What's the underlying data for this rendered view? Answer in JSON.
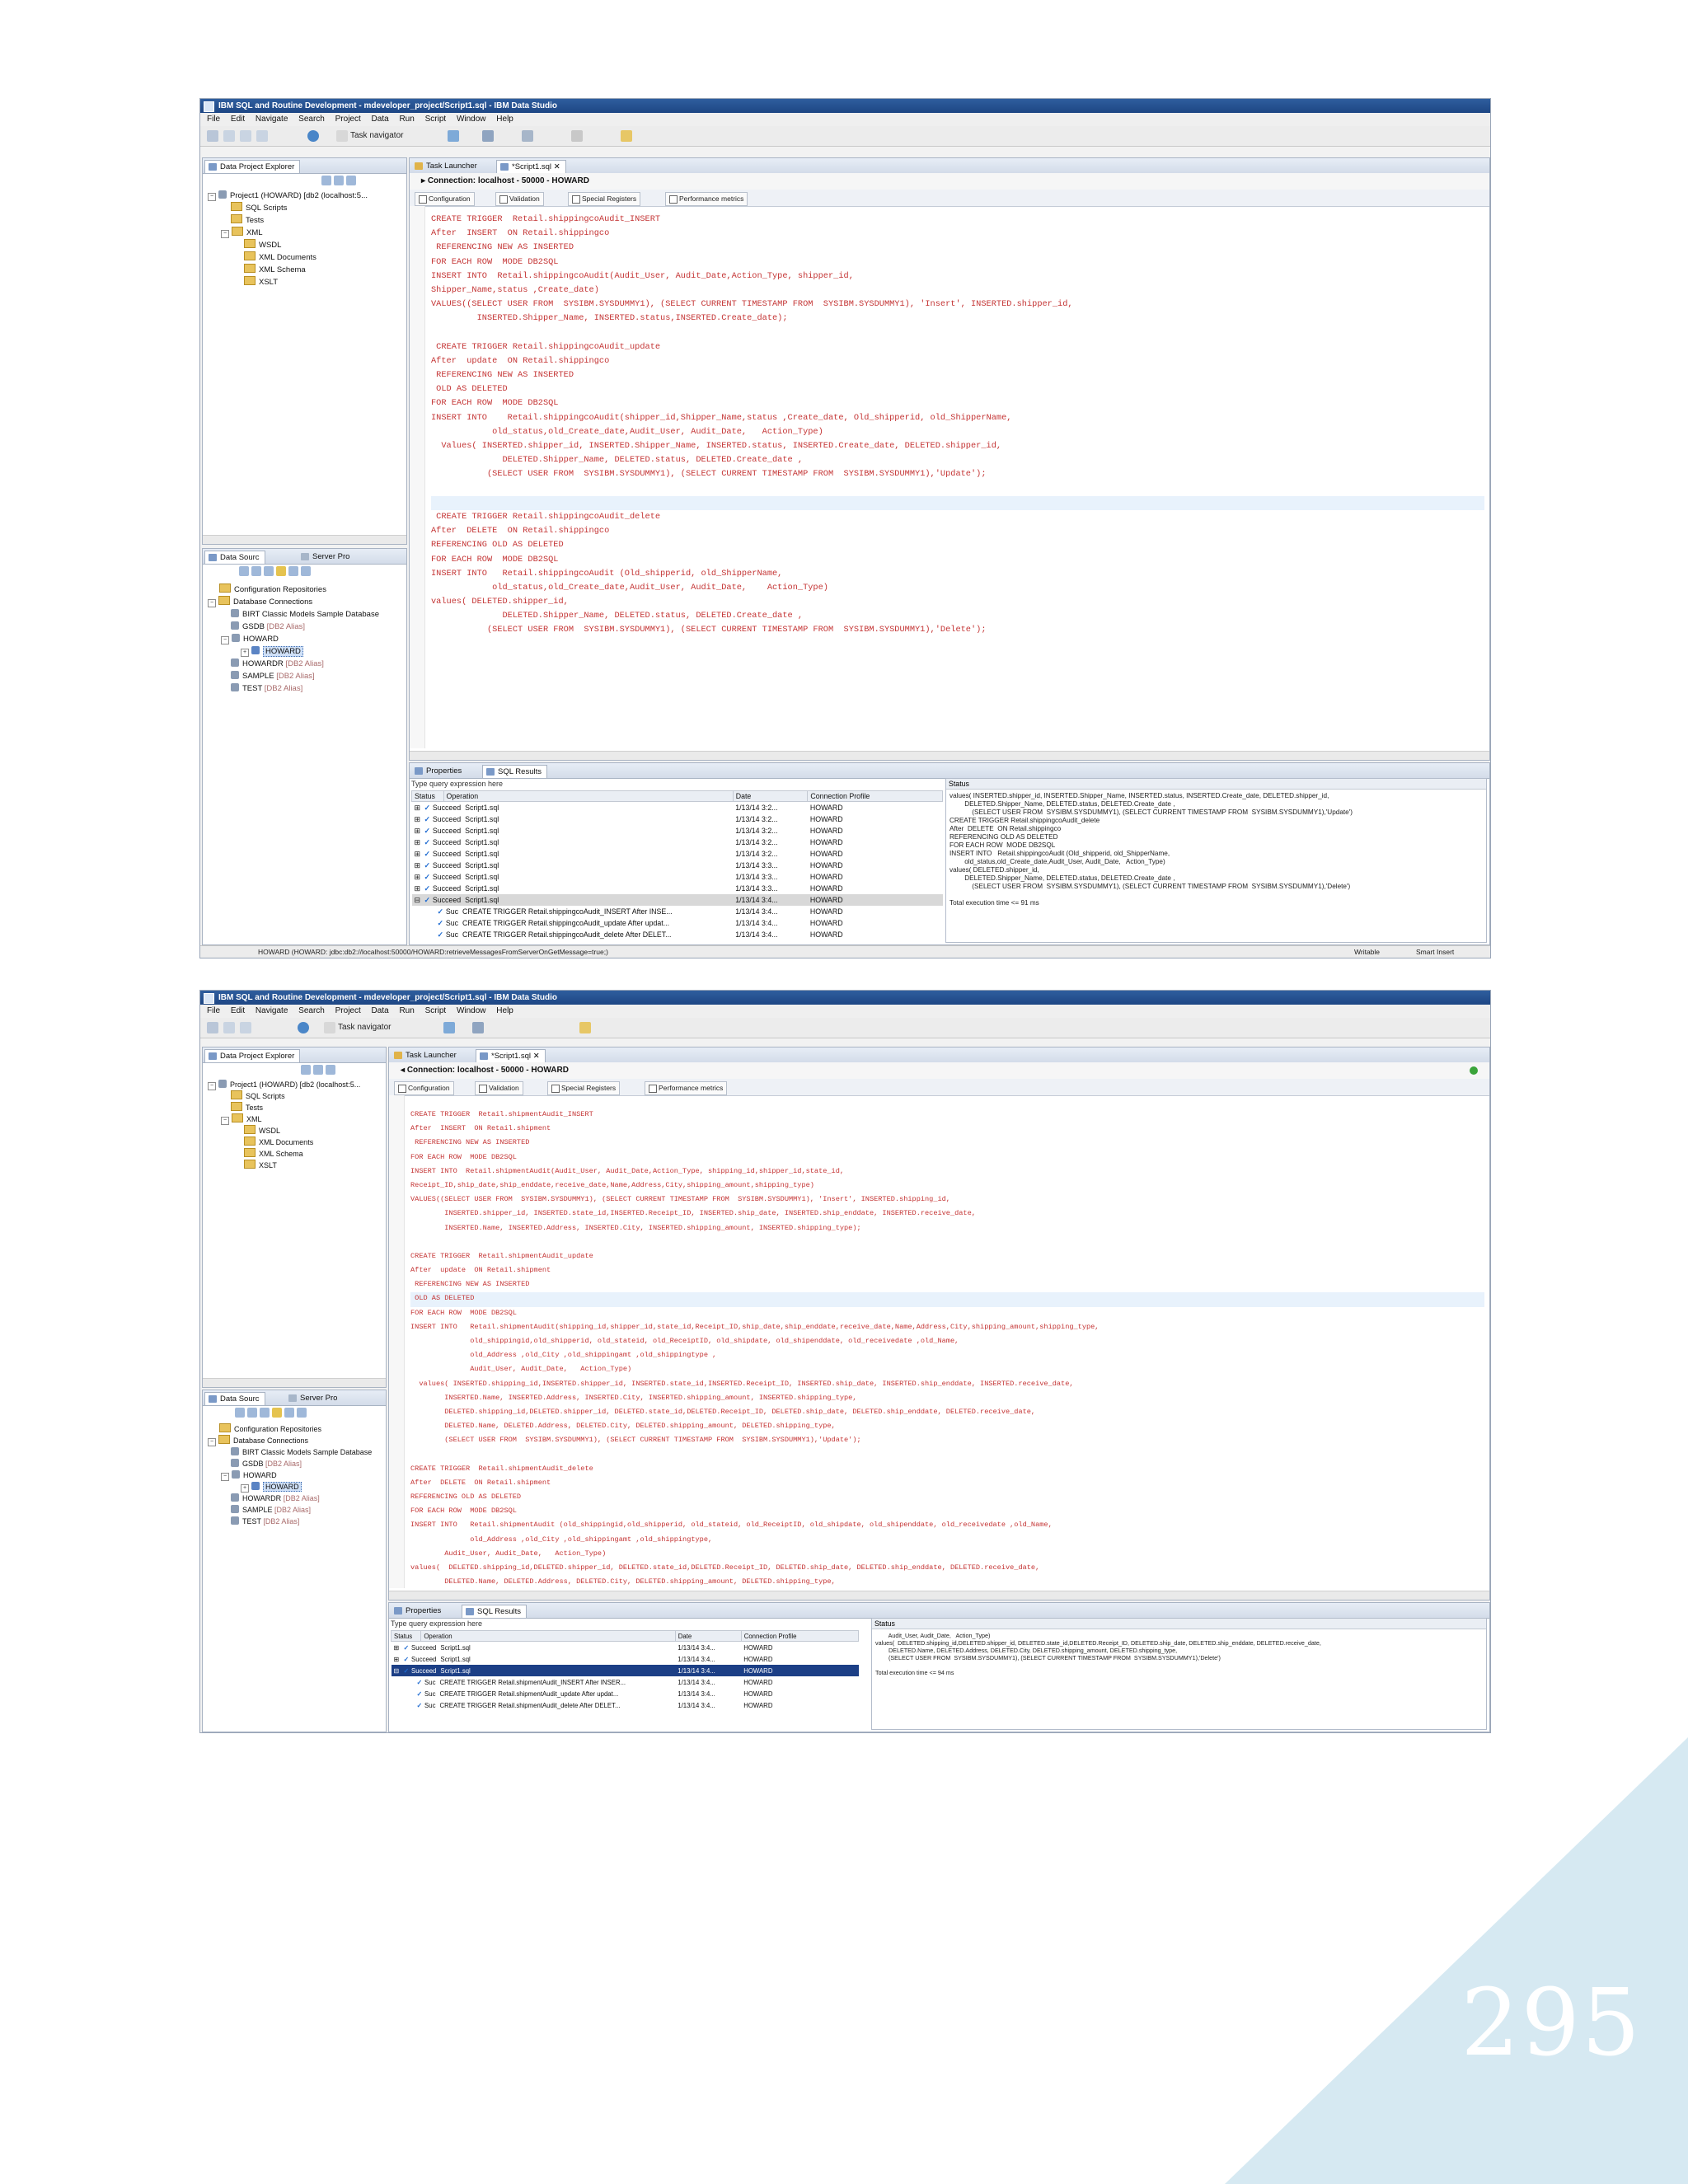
{
  "page": {
    "page_number": "295",
    "triangle_color": "#d6e9f2"
  },
  "screen1": {
    "title": "IBM SQL and Routine Development - mdeveloper_project/Script1.sql - IBM Data Studio",
    "menu": [
      "File",
      "Edit",
      "Navigate",
      "Search",
      "Project",
      "Data",
      "Run",
      "Script",
      "Window",
      "Help"
    ],
    "toolbar_task_navigator": "Task navigator",
    "explorer": {
      "tab": "Data Project Explorer",
      "items": [
        {
          "label": "Project1 (HOWARD) [db2 (localhost:5...",
          "level": 0
        },
        {
          "label": "SQL Scripts",
          "level": 1
        },
        {
          "label": "Tests",
          "level": 1
        },
        {
          "label": "XML",
          "level": 1
        },
        {
          "label": "WSDL",
          "level": 2
        },
        {
          "label": "XML Documents",
          "level": 2
        },
        {
          "label": "XML Schema",
          "level": 2
        },
        {
          "label": "XSLT",
          "level": 2
        }
      ]
    },
    "datasource": {
      "tab": "Data Sourc",
      "tab2": "Server Pro",
      "items": [
        {
          "label": "Configuration Repositories",
          "level": 0,
          "status": ""
        },
        {
          "label": "Database Connections",
          "level": 0,
          "status": ""
        },
        {
          "label": "BIRT Classic Models Sample Database",
          "level": 1,
          "status": ""
        },
        {
          "label": "GSDB",
          "level": 1,
          "status": "[DB2 Alias]"
        },
        {
          "label": "HOWARD",
          "level": 1,
          "status": ""
        },
        {
          "label": "HOWARD",
          "level": 2,
          "status": "",
          "selected": true
        },
        {
          "label": "HOWARDR",
          "level": 1,
          "status": "[DB2 Alias]"
        },
        {
          "label": "SAMPLE",
          "level": 1,
          "status": "[DB2 Alias]"
        },
        {
          "label": "TEST",
          "level": 1,
          "status": "[DB2 Alias]"
        }
      ]
    },
    "editor": {
      "tab_launcher": "Task Launcher",
      "tab_script": "*Script1.sql",
      "connection": "Connection: localhost - 50000 - HOWARD",
      "subtabs": [
        "Configuration",
        "Validation",
        "Special Registers",
        "Performance metrics"
      ],
      "code": [
        "CREATE TRIGGER  Retail.shippingcoAudit_INSERT",
        "After  INSERT  ON Retail.shippingco",
        " REFERENCING NEW AS INSERTED",
        "FOR EACH ROW  MODE DB2SQL",
        "INSERT INTO  Retail.shippingcoAudit(Audit_User, Audit_Date,Action_Type, shipper_id,",
        "Shipper_Name,status ,Create_date)",
        "VALUES((SELECT USER FROM  SYSIBM.SYSDUMMY1), (SELECT CURRENT TIMESTAMP FROM  SYSIBM.SYSDUMMY1), 'Insert', INSERTED.shipper_id,",
        "         INSERTED.Shipper_Name, INSERTED.status,INSERTED.Create_date);",
        "",
        " CREATE TRIGGER Retail.shippingcoAudit_update",
        "After  update  ON Retail.shippingco",
        " REFERENCING NEW AS INSERTED",
        " OLD AS DELETED",
        "FOR EACH ROW  MODE DB2SQL",
        "INSERT INTO    Retail.shippingcoAudit(shipper_id,Shipper_Name,status ,Create_date, Old_shipperid, old_ShipperName,",
        "            old_status,old_Create_date,Audit_User, Audit_Date,   Action_Type)",
        "  Values( INSERTED.shipper_id, INSERTED.Shipper_Name, INSERTED.status, INSERTED.Create_date, DELETED.shipper_id,",
        "              DELETED.Shipper_Name, DELETED.status, DELETED.Create_date ,",
        "           (SELECT USER FROM  SYSIBM.SYSDUMMY1), (SELECT CURRENT TIMESTAMP FROM  SYSIBM.SYSDUMMY1),'Update');",
        "",
        "",
        " CREATE TRIGGER Retail.shippingcoAudit_delete",
        "After  DELETE  ON Retail.shippingco",
        "REFERENCING OLD AS DELETED",
        "FOR EACH ROW  MODE DB2SQL",
        "INSERT INTO   Retail.shippingcoAudit (Old_shipperid, old_ShipperName,",
        "            old_status,old_Create_date,Audit_User, Audit_Date,    Action_Type)",
        "values( DELETED.shipper_id,",
        "              DELETED.Shipper_Name, DELETED.status, DELETED.Create_date ,",
        "           (SELECT USER FROM  SYSIBM.SYSDUMMY1), (SELECT CURRENT TIMESTAMP FROM  SYSIBM.SYSDUMMY1),'Delete');"
      ]
    },
    "results": {
      "tab_properties": "Properties",
      "tab_sql_results": "SQL Results",
      "filter": "Type query expression here",
      "headers": [
        "Status",
        "Operation",
        "Date",
        "Connection Profile"
      ],
      "rows": [
        {
          "status": "Succeed",
          "operation": "Script1.sql",
          "date": "1/13/14 3:2...",
          "profile": "HOWARD",
          "child": false
        },
        {
          "status": "Succeed",
          "operation": "Script1.sql",
          "date": "1/13/14 3:2...",
          "profile": "HOWARD",
          "child": false
        },
        {
          "status": "Succeed",
          "operation": "Script1.sql",
          "date": "1/13/14 3:2...",
          "profile": "HOWARD",
          "child": false
        },
        {
          "status": "Succeed",
          "operation": "Script1.sql",
          "date": "1/13/14 3:2...",
          "profile": "HOWARD",
          "child": false
        },
        {
          "status": "Succeed",
          "operation": "Script1.sql",
          "date": "1/13/14 3:2...",
          "profile": "HOWARD",
          "child": false
        },
        {
          "status": "Succeed",
          "operation": "Script1.sql",
          "date": "1/13/14 3:3...",
          "profile": "HOWARD",
          "child": false
        },
        {
          "status": "Succeed",
          "operation": "Script1.sql",
          "date": "1/13/14 3:3...",
          "profile": "HOWARD",
          "child": false
        },
        {
          "status": "Succeed",
          "operation": "Script1.sql",
          "date": "1/13/14 3:3...",
          "profile": "HOWARD",
          "child": false
        },
        {
          "status": "Succeed",
          "operation": "Script1.sql",
          "date": "1/13/14 3:4...",
          "profile": "HOWARD",
          "child": false,
          "selected": true
        },
        {
          "status": "Suc",
          "operation": "CREATE TRIGGER Retail.shippingcoAudit_INSERT  After  INSE...",
          "date": "1/13/14 3:4...",
          "profile": "HOWARD",
          "child": true
        },
        {
          "status": "Suc",
          "operation": "CREATE TRIGGER Retail.shippingcoAudit_update  After  updat...",
          "date": "1/13/14 3:4...",
          "profile": "HOWARD",
          "child": true
        },
        {
          "status": "Suc",
          "operation": "CREATE TRIGGER Retail.shippingcoAudit_delete  After  DELET...",
          "date": "1/13/14 3:4...",
          "profile": "HOWARD",
          "child": true
        }
      ],
      "status_header": "Status",
      "status_text": "values( INSERTED.shipper_id, INSERTED.Shipper_Name, INSERTED.status, INSERTED.Create_date, DELETED.shipper_id,\n        DELETED.Shipper_Name, DELETED.status, DELETED.Create_date ,\n            (SELECT USER FROM  SYSIBM.SYSDUMMY1), (SELECT CURRENT TIMESTAMP FROM  SYSIBM.SYSDUMMY1),'Update')\nCREATE TRIGGER Retail.shippingcoAudit_delete\nAfter  DELETE  ON Retail.shippingco\nREFERENCING OLD AS DELETED\nFOR EACH ROW  MODE DB2SQL\nINSERT INTO   Retail.shippingcoAudit (Old_shipperid, old_ShipperName,\n        old_status,old_Create_date,Audit_User, Audit_Date,   Action_Type)\nvalues( DELETED.shipper_id,\n        DELETED.Shipper_Name, DELETED.status, DELETED.Create_date ,\n            (SELECT USER FROM  SYSIBM.SYSDUMMY1), (SELECT CURRENT TIMESTAMP FROM  SYSIBM.SYSDUMMY1),'Delete')\n\nTotal execution time <= 91 ms"
    },
    "statusbar": {
      "text": "HOWARD (HOWARD: jdbc:db2://localhost:50000/HOWARD:retrieveMessagesFromServerOnGetMessage=true;)",
      "writable": "Writable",
      "insert": "Smart Insert"
    }
  },
  "screen2": {
    "title": "IBM SQL and Routine Development - mdeveloper_project/Script1.sql - IBM Data Studio",
    "menu": [
      "File",
      "Edit",
      "Navigate",
      "Search",
      "Project",
      "Data",
      "Run",
      "Script",
      "Window",
      "Help"
    ],
    "toolbar_task_navigator": "Task navigator",
    "explorer": {
      "tab": "Data Project Explorer",
      "items": [
        {
          "label": "Project1 (HOWARD) [db2 (localhost:5...",
          "level": 0
        },
        {
          "label": "SQL Scripts",
          "level": 1
        },
        {
          "label": "Tests",
          "level": 1
        },
        {
          "label": "XML",
          "level": 1
        },
        {
          "label": "WSDL",
          "level": 2
        },
        {
          "label": "XML Documents",
          "level": 2
        },
        {
          "label": "XML Schema",
          "level": 2
        },
        {
          "label": "XSLT",
          "level": 2
        }
      ]
    },
    "datasource": {
      "tab": "Data Sourc",
      "tab2": "Server Pro",
      "items": [
        {
          "label": "Configuration Repositories",
          "level": 0,
          "status": ""
        },
        {
          "label": "Database Connections",
          "level": 0,
          "status": ""
        },
        {
          "label": "BIRT Classic Models Sample Database",
          "level": 1,
          "status": ""
        },
        {
          "label": "GSDB",
          "level": 1,
          "status": "[DB2 Alias]"
        },
        {
          "label": "HOWARD",
          "level": 1,
          "status": ""
        },
        {
          "label": "HOWARD",
          "level": 2,
          "status": "",
          "selected": true
        },
        {
          "label": "HOWARDR",
          "level": 1,
          "status": "[DB2 Alias]"
        },
        {
          "label": "SAMPLE",
          "level": 1,
          "status": "[DB2 Alias]"
        },
        {
          "label": "TEST",
          "level": 1,
          "status": "[DB2 Alias]"
        }
      ]
    },
    "editor": {
      "tab_launcher": "Task Launcher",
      "tab_script": "*Script1.sql",
      "connection": "Connection: localhost - 50000 - HOWARD",
      "subtabs": [
        "Configuration",
        "Validation",
        "Special Registers",
        "Performance metrics"
      ],
      "code": [
        "CREATE TRIGGER  Retail.shipmentAudit_INSERT",
        "After  INSERT  ON Retail.shipment",
        " REFERENCING NEW AS INSERTED",
        "FOR EACH ROW  MODE DB2SQL",
        "INSERT INTO  Retail.shipmentAudit(Audit_User, Audit_Date,Action_Type, shipping_id,shipper_id,state_id,",
        "Receipt_ID,ship_date,ship_enddate,receive_date,Name,Address,City,shipping_amount,shipping_type)",
        "VALUES((SELECT USER FROM  SYSIBM.SYSDUMMY1), (SELECT CURRENT TIMESTAMP FROM  SYSIBM.SYSDUMMY1), 'Insert', INSERTED.shipping_id,",
        "        INSERTED.shipper_id, INSERTED.state_id,INSERTED.Receipt_ID, INSERTED.ship_date, INSERTED.ship_enddate, INSERTED.receive_date,",
        "        INSERTED.Name, INSERTED.Address, INSERTED.City, INSERTED.shipping_amount, INSERTED.shipping_type);",
        "",
        "CREATE TRIGGER  Retail.shipmentAudit_update",
        "After  update  ON Retail.shipment",
        " REFERENCING NEW AS INSERTED",
        " OLD AS DELETED",
        "FOR EACH ROW  MODE DB2SQL",
        "INSERT INTO   Retail.shipmentAudit(shipping_id,shipper_id,state_id,Receipt_ID,ship_date,ship_enddate,receive_date,Name,Address,City,shipping_amount,shipping_type,",
        "              old_shippingid,old_shipperid, old_stateid, old_ReceiptID, old_shipdate, old_shipenddate, old_receivedate ,old_Name,",
        "              old_Address ,old_City ,old_shippingamt ,old_shippingtype ,",
        "              Audit_User, Audit_Date,   Action_Type)",
        "  values( INSERTED.shipping_id,INSERTED.shipper_id, INSERTED.state_id,INSERTED.Receipt_ID, INSERTED.ship_date, INSERTED.ship_enddate, INSERTED.receive_date,",
        "        INSERTED.Name, INSERTED.Address, INSERTED.City, INSERTED.shipping_amount, INSERTED.shipping_type,",
        "        DELETED.shipping_id,DELETED.shipper_id, DELETED.state_id,DELETED.Receipt_ID, DELETED.ship_date, DELETED.ship_enddate, DELETED.receive_date,",
        "        DELETED.Name, DELETED.Address, DELETED.City, DELETED.shipping_amount, DELETED.shipping_type,",
        "        (SELECT USER FROM  SYSIBM.SYSDUMMY1), (SELECT CURRENT TIMESTAMP FROM  SYSIBM.SYSDUMMY1),'Update');",
        "",
        "CREATE TRIGGER  Retail.shipmentAudit_delete",
        "After  DELETE  ON Retail.shipment",
        "REFERENCING OLD AS DELETED",
        "FOR EACH ROW  MODE DB2SQL",
        "INSERT INTO   Retail.shipmentAudit (old_shippingid,old_shipperid, old_stateid, old_ReceiptID, old_shipdate, old_shipenddate, old_receivedate ,old_Name,",
        "              old_Address ,old_City ,old_shippingamt ,old_shippingtype,",
        "        Audit_User, Audit_Date,   Action_Type)",
        "values(  DELETED.shipping_id,DELETED.shipper_id, DELETED.state_id,DELETED.Receipt_ID, DELETED.ship_date, DELETED.ship_enddate, DELETED.receive_date,",
        "        DELETED.Name, DELETED.Address, DELETED.City, DELETED.shipping_amount, DELETED.shipping_type,",
        "        (SELECT USER FROM  SYSIBM.SYSDUMMY1), (SELECT CURRENT TIMESTAMP FROM  SYSIBM.SYSDUMMY1),'Delete');"
      ]
    },
    "results": {
      "tab_properties": "Properties",
      "tab_sql_results": "SQL Results",
      "filter": "Type query expression here",
      "headers": [
        "Status",
        "Operation",
        "Date",
        "Connection Profile"
      ],
      "rows": [
        {
          "status": "Succeed",
          "operation": "Script1.sql",
          "date": "1/13/14 3:4...",
          "profile": "HOWARD",
          "child": false
        },
        {
          "status": "Succeed",
          "operation": "Script1.sql",
          "date": "1/13/14 3:4...",
          "profile": "HOWARD",
          "child": false
        },
        {
          "status": "Succeed",
          "operation": "Script1.sql",
          "date": "1/13/14 3:4...",
          "profile": "HOWARD",
          "child": false,
          "selected": true
        },
        {
          "status": "Suc",
          "operation": "CREATE TRIGGER Retail.shipmentAudit_INSERT  After  INSER...",
          "date": "1/13/14 3:4...",
          "profile": "HOWARD",
          "child": true
        },
        {
          "status": "Suc",
          "operation": "CREATE TRIGGER Retail.shipmentAudit_update  After  updat...",
          "date": "1/13/14 3:4...",
          "profile": "HOWARD",
          "child": true
        },
        {
          "status": "Suc",
          "operation": "CREATE TRIGGER Retail.shipmentAudit_delete  After  DELET...",
          "date": "1/13/14 3:4...",
          "profile": "HOWARD",
          "child": true
        }
      ],
      "status_header": "Status",
      "status_text": "        Audit_User, Audit_Date,   Action_Type)\nvalues(  DELETED.shipping_id,DELETED.shipper_id, DELETED.state_id,DELETED.Receipt_ID, DELETED.ship_date, DELETED.ship_enddate, DELETED.receive_date,\n        DELETED.Name, DELETED.Address, DELETED.City, DELETED.shipping_amount, DELETED.shipping_type,\n        (SELECT USER FROM  SYSIBM.SYSDUMMY1), (SELECT CURRENT TIMESTAMP FROM  SYSIBM.SYSDUMMY1),'Delete')\n\nTotal execution time <= 94 ms"
    }
  }
}
